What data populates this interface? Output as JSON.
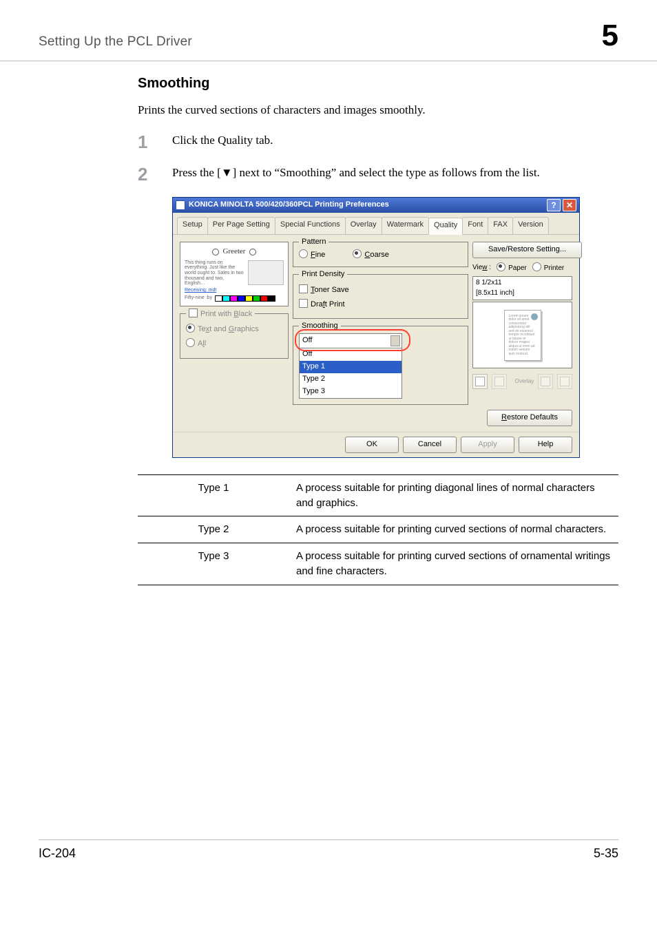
{
  "page": {
    "header_left": "Setting Up the PCL Driver",
    "header_right": "5",
    "footer_left": "IC-204",
    "footer_right": "5-35"
  },
  "section": {
    "title": "Smoothing",
    "intro": "Prints the curved sections of characters and images smoothly."
  },
  "steps": {
    "s1_num": "1",
    "s1_text": "Click the Quality tab.",
    "s2_num": "2",
    "s2_text": "Press the [▼] next to “Smoothing” and select the type as follows from the list."
  },
  "dialog": {
    "title": "KONICA MINOLTA 500/420/360PCL Printing Preferences",
    "qmark": "?",
    "xmark": "✕",
    "tabs": [
      "Setup",
      "Per Page Setting",
      "Special Functions",
      "Overlay",
      "Watermark",
      "Quality",
      "Font",
      "FAX",
      "Version"
    ],
    "selected_tab_index": 5,
    "left": {
      "greeter": "Greeter",
      "blurb": "This thing runs on everything. Just like the world ought to. Sales in two thousand and two, English…",
      "link": "Receiving: mdt",
      "sub": "Fifty-nine :by",
      "group_title": "Print with Black",
      "opt_textgraphics": "Text and Graphics",
      "opt_all": "All"
    },
    "mid": {
      "pattern_title": "Pattern",
      "opt_fine": "Fine",
      "opt_coarse": "Coarse",
      "density_title": "Print Density",
      "opt_tonersave": "Toner Save",
      "opt_draft": "Draft Print",
      "smoothing_title": "Smoothing",
      "dd_value": "Off",
      "dd_items": [
        "Off",
        "Type 1",
        "Type 2",
        "Type 3"
      ],
      "dd_sel_index": 1
    },
    "right": {
      "save_restore": "Save/Restore Setting...",
      "view_label": "View :",
      "opt_paper": "Paper",
      "opt_printer": "Printer",
      "paper_size": "8 1/2x11",
      "paper_dim": "[8.5x11 inch]",
      "restore": "Restore Defaults",
      "overlay_badge": "Overlay"
    },
    "footer": {
      "ok": "OK",
      "cancel": "Cancel",
      "apply": "Apply",
      "help": "Help"
    }
  },
  "types": [
    {
      "name": "Type 1",
      "desc": "A process suitable for printing diagonal lines of normal characters and graphics."
    },
    {
      "name": "Type 2",
      "desc": "A process suitable for printing curved sections of normal characters."
    },
    {
      "name": "Type 3",
      "desc": "A process suitable for printing curved sections of ornamental writings and fine characters."
    }
  ]
}
